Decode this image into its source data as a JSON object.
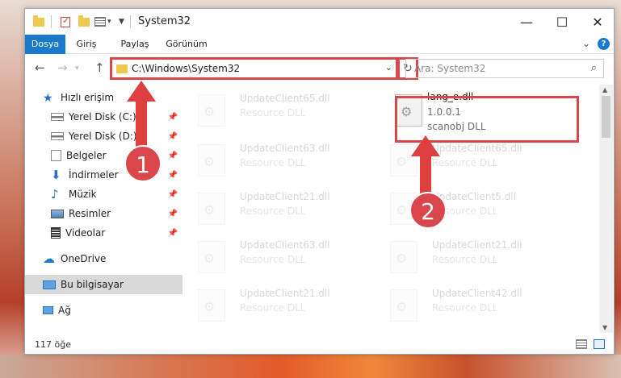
{
  "window": {
    "title": "System32"
  },
  "ribbon": {
    "tabs": [
      "Dosya",
      "Giriş",
      "Paylaş",
      "Görünüm"
    ]
  },
  "address": {
    "path": "C:\\Windows\\System32"
  },
  "search": {
    "placeholder": "Ara: System32"
  },
  "nav_pane": {
    "items": [
      {
        "label": "Hızlı erişim",
        "icon": "star-icon"
      },
      {
        "label": "Yerel Disk (C:)",
        "icon": "drive-icon",
        "pinned": true
      },
      {
        "label": "Yerel Disk (D:)",
        "icon": "drive-icon",
        "pinned": true
      },
      {
        "label": "Belgeler",
        "icon": "documents-icon",
        "pinned": true
      },
      {
        "label": "İndirmeler",
        "icon": "download-icon",
        "pinned": true
      },
      {
        "label": "Müzik",
        "icon": "music-icon",
        "pinned": true
      },
      {
        "label": "Resimler",
        "icon": "pictures-icon",
        "pinned": true
      },
      {
        "label": "Videolar",
        "icon": "video-icon",
        "pinned": true
      },
      {
        "label": "OneDrive",
        "icon": "cloud-icon"
      },
      {
        "label": "Bu bilgisayar",
        "icon": "computer-icon",
        "selected": true
      },
      {
        "label": "Ağ",
        "icon": "network-icon"
      }
    ]
  },
  "files": {
    "highlighted": {
      "name": "lang_e.dll",
      "version": "1.0.0.1",
      "description": "scanobj DLL"
    },
    "left_column": [
      {
        "name": "UpdateClient65.dll",
        "type": "Resource DLL"
      },
      {
        "name": "UpdateClient63.dll",
        "type": "Resource DLL"
      },
      {
        "name": "UpdateClient21.dll",
        "type": "Resource DLL"
      },
      {
        "name": "UpdateClient63.dll",
        "type": "Resource DLL"
      },
      {
        "name": "UpdateClient21.dll",
        "type": "Resource DLL"
      }
    ],
    "right_column": [
      {
        "name": "UpdateClient65.dll",
        "type": "Resource DLL"
      },
      {
        "name": "UpdateClient5.dll",
        "type": "Resource DLL"
      },
      {
        "name": "UpdateClient21.dll",
        "type": "Resource DLL"
      },
      {
        "name": "UpdateClient42.dll",
        "type": "Resource DLL"
      }
    ]
  },
  "status": {
    "item_count": "117 öğe"
  },
  "annotations": {
    "step1": "1",
    "step2": "2"
  },
  "colors": {
    "accent": "#1979ca",
    "annotation": "#d9464b"
  }
}
